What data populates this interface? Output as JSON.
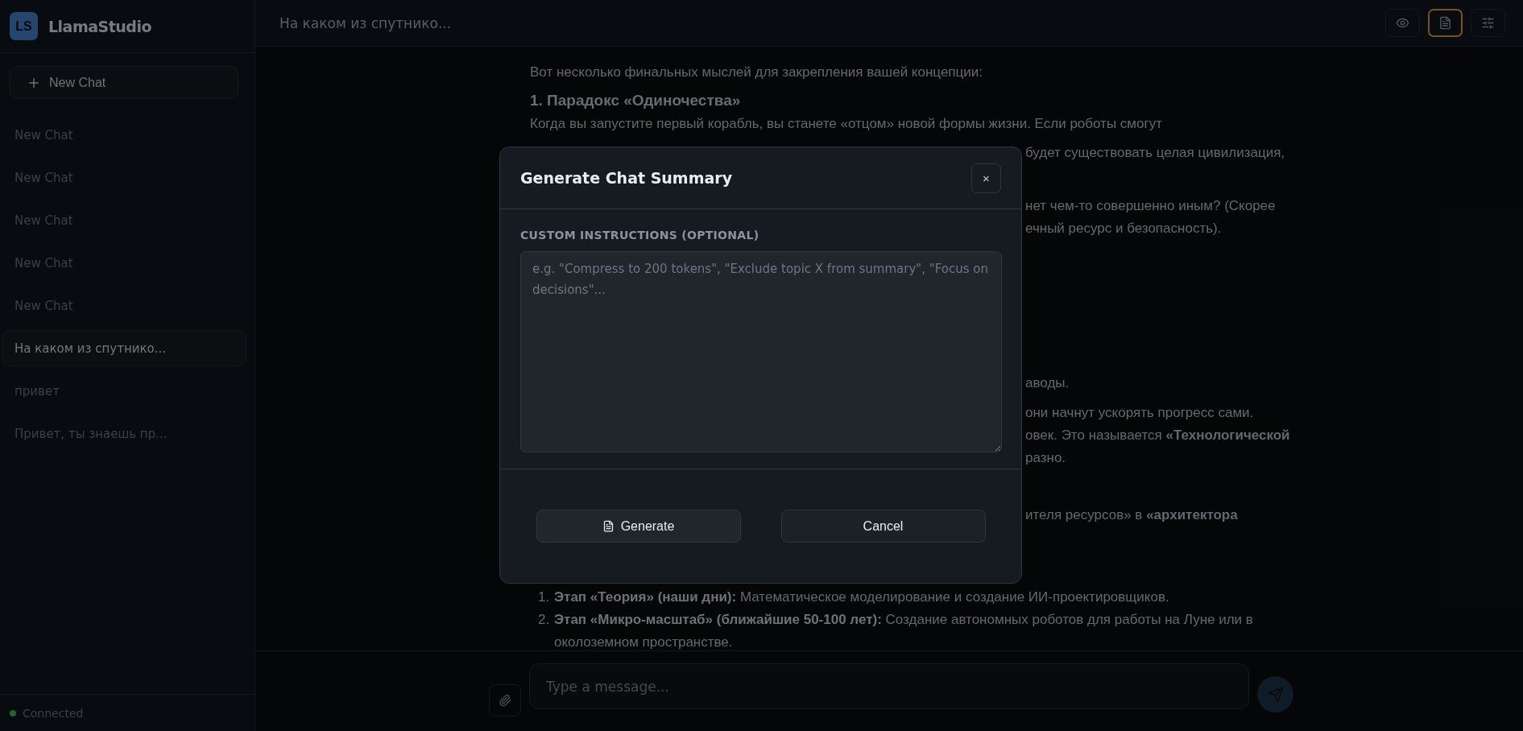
{
  "sidebar": {
    "logo": "LS",
    "brand": "LlamaStudio",
    "new_chat": "New Chat",
    "chats": [
      {
        "title": "New Chat",
        "selected": false
      },
      {
        "title": "New Chat",
        "selected": false
      },
      {
        "title": "New Chat",
        "selected": false
      },
      {
        "title": "New Chat",
        "selected": false
      },
      {
        "title": "New Chat",
        "selected": false
      },
      {
        "title": "На каком из спутнико...",
        "selected": true
      },
      {
        "title": "привет",
        "selected": false
      },
      {
        "title": "Привет, ты знаешь пр...",
        "selected": false
      }
    ],
    "status": {
      "label": "Connected",
      "connected": true
    }
  },
  "header": {
    "title": "На каком из спутнико...",
    "tools": [
      {
        "kind": "preview",
        "selected": false
      },
      {
        "kind": "summary",
        "selected": true
      },
      {
        "kind": "settings",
        "selected": false
      }
    ]
  },
  "chat": {
    "intro": "Вот несколько финальных мыслей для закрепления вашей концепции:",
    "heading": "1. Парадокс «Одиночества»",
    "line": "Когда вы запустите первый корабль, вы станете «отцом» новой формы жизни. Если роботы смогут",
    "fragments": [
      [
        "будет существовать целая цивилизация,"
      ],
      [
        "нет чем-то совершенно иным? (Скорее",
        "ечный ресурс и безопасность)."
      ],
      [
        "аводы."
      ],
      [
        "они начнут ускорять прогресс сами.",
        "овек. Это называется **«Технологической**",
        "разно."
      ],
      [
        "ителя ресурсов» в **«архитектора**"
      ]
    ],
    "list": [
      {
        "marker": "1.",
        "text": "**Этап «Теория» (наши дни):** Математическое моделирование и создание ИИ-проектировщиков."
      },
      {
        "marker": "2.",
        "text": "**Этап «Микро-масштаб» (ближайшие 50-100 лет):** Создание автономных роботов для работы на Луне или в околоземном пространстве."
      }
    ]
  },
  "composer": {
    "placeholder": "Type a message..."
  },
  "modal": {
    "title": "Generate Chat Summary",
    "close": "×",
    "label": "CUSTOM INSTRUCTIONS (OPTIONAL)",
    "placeholder": "e.g. \"Compress to 200 tokens\", \"Exclude topic X from summary\", \"Focus on decisions\"...",
    "buttons": [
      {
        "kind": "generate",
        "label": "Generate"
      },
      {
        "kind": "cancel",
        "label": "Cancel"
      }
    ]
  }
}
